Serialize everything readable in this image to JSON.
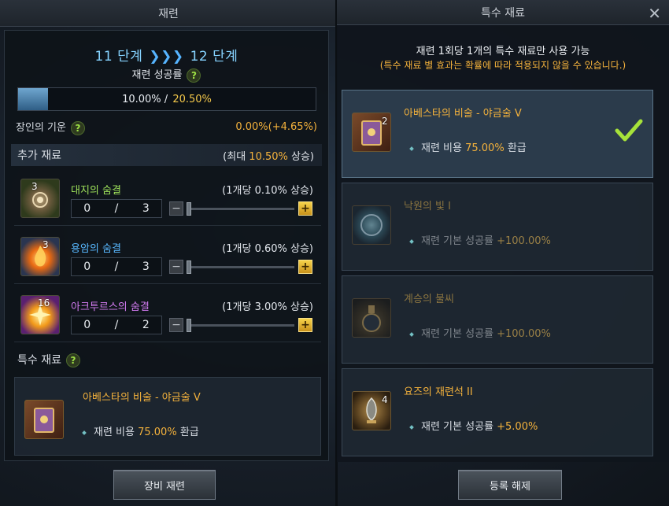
{
  "left": {
    "title": "재련",
    "stage_from": "11 단계",
    "stage_arrows": "❯❯❯",
    "stage_to": "12 단계",
    "success_rate_label": "재련 성공률",
    "bar": {
      "current": "10.00%",
      "sep": " / ",
      "total": "20.50%",
      "fill_percent": 10
    },
    "spirit": {
      "label": "장인의 기운",
      "value": "0.00%(+4.65%)"
    },
    "extra": {
      "label": "추가 재료",
      "max_prefix": "(최대 ",
      "max_value": "10.50%",
      "max_suffix": " 상승)",
      "items": [
        {
          "name": "대지의 숨결",
          "count": "3",
          "per": "(1개당 0.10% 상승)",
          "qty": "0",
          "slash": "/",
          "max": "3",
          "color": "#9fe35a"
        },
        {
          "name": "용암의 숨결",
          "count": "3",
          "per": "(1개당 0.60% 상승)",
          "qty": "0",
          "slash": "/",
          "max": "3",
          "color": "#58b8ff"
        },
        {
          "name": "아크투르스의 숨결",
          "count": "16",
          "per": "(1개당 3.00% 상승)",
          "qty": "0",
          "slash": "/",
          "max": "2",
          "color": "#d27bf0"
        }
      ]
    },
    "special": {
      "label": "특수 재료",
      "name": "아베스타의 비술 - 야금술 V",
      "desc_prefix": "재련 비용 ",
      "desc_value": "75.00%",
      "desc_suffix": " 환급"
    },
    "button": "장비 재련"
  },
  "right": {
    "title": "특수 재료",
    "notice1": "재련 1회당 1개의 특수 재료만 사용 가능",
    "notice2": "(특수 재료 별 효과는 확률에 따라 적용되지 않을 수 있습니다.)",
    "cards": [
      {
        "name": "아베스타의 비술 - 야금술 V",
        "count": "2",
        "desc": "재련 비용 ",
        "value": "75.00%",
        "suffix": " 환급",
        "selected": true
      },
      {
        "name": "낙원의 빛 I",
        "count": "",
        "desc": "재련 기본 성공률 ",
        "value": "+100.00%",
        "suffix": ""
      },
      {
        "name": "계승의 불씨",
        "count": "",
        "desc": "재련 기본 성공률 ",
        "value": "+100.00%",
        "suffix": ""
      },
      {
        "name": "요즈의 재련석 II",
        "count": "4",
        "desc": "재련 기본 성공률 ",
        "value": "+5.00%",
        "suffix": ""
      }
    ],
    "button": "등록 해제",
    "close": "✕"
  },
  "colors": {
    "accent": "#f4b23c",
    "help": "#9ee245",
    "stage": "#86d3ff"
  },
  "icons": [
    "book-icon",
    "earth-breath-icon",
    "lava-breath-icon",
    "arcturus-breath-icon",
    "orb-icon",
    "potion-icon",
    "refine-stone-icon",
    "check-icon",
    "help-icon",
    "close-icon"
  ]
}
